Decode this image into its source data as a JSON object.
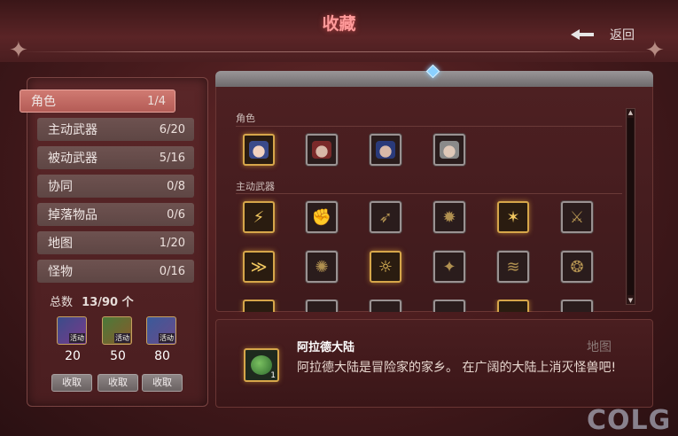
{
  "header": {
    "title": "收藏",
    "back_label": "返回"
  },
  "categories": [
    {
      "label": "角色",
      "count": "1/4"
    },
    {
      "label": "主动武器",
      "count": "6/20"
    },
    {
      "label": "被动武器",
      "count": "5/16"
    },
    {
      "label": "协同",
      "count": "0/8"
    },
    {
      "label": "掉落物品",
      "count": "0/6"
    },
    {
      "label": "地图",
      "count": "1/20"
    },
    {
      "label": "怪物",
      "count": "0/16"
    }
  ],
  "total": {
    "label": "总数",
    "value": "13/90 个"
  },
  "rewards": [
    {
      "value": "20",
      "badge": "活动",
      "claim_label": "收取"
    },
    {
      "value": "50",
      "badge": "活动",
      "claim_label": "收取"
    },
    {
      "value": "80",
      "badge": "活动",
      "claim_label": "收取"
    }
  ],
  "grid": {
    "sections": [
      {
        "label": "角色"
      },
      {
        "label": "主动武器"
      }
    ]
  },
  "detail": {
    "name": "阿拉德大陆",
    "type": "地图",
    "description": "阿拉德大陆是冒险家的家乡。 在广阔的大陆上消灭怪兽吧!",
    "level": "1"
  },
  "icons": {
    "back": "arrow-left-icon",
    "corner_ornament": "four-point-star-icon"
  },
  "colors": {
    "title": "#ff9a9a",
    "active_tab": "#c46a62",
    "gold_frame": "#d6a64a",
    "gray_frame": "#9a9292"
  },
  "watermark": "COLG"
}
